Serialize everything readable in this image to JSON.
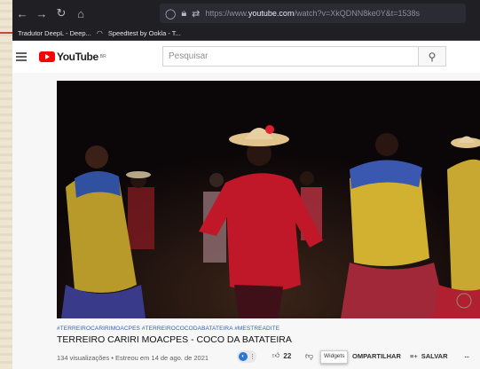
{
  "browser": {
    "nav_icons": [
      "back-arrow-icon",
      "forward-arrow-icon",
      "reload-icon",
      "home-icon"
    ],
    "url_prefix": "https://www.",
    "url_host": "youtube.com",
    "url_path": "/watch?v=XkQDNN8ke0Y&t=1538s",
    "bookmarks": [
      "Tradutor DeepL - Deep...",
      "Speedtest by Ookla - T..."
    ]
  },
  "youtube": {
    "logo_text": "YouTube",
    "logo_region": "BR",
    "search_placeholder": "Pesquisar"
  },
  "video": {
    "hashtags": "#TERREIROCARIRIMOACPES #TERREIROCOCODABATATEIRA #MESTREADITE",
    "title": "TERREIRO CARIRI MOACPES - COCO DA BATATEIRA",
    "meta": "134 visualizações • Estreou em 14 de ago. de 2021",
    "likes": "22",
    "widgets_label": "Widgets",
    "share_label": "OMPARTILHAR",
    "save_label": "SALVAR",
    "more_label": "..."
  },
  "colors": {
    "accent": "#ff0000",
    "hashtag": "#3060b4",
    "browser_bar": "#1f1f24"
  }
}
